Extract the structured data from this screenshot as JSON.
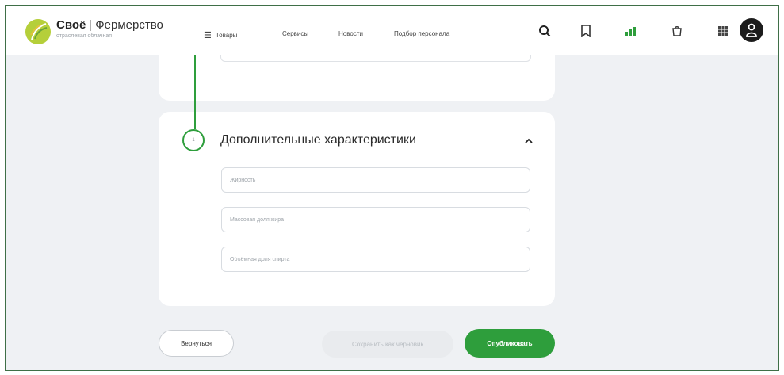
{
  "header": {
    "logo": {
      "brand": "Своё",
      "separator": "|",
      "product": "Фермерство",
      "tagline": "отраслевая облачная"
    },
    "nav": [
      {
        "label": "Товары",
        "icon": "menu-icon"
      },
      {
        "label": "Сервисы"
      },
      {
        "label": "Новости"
      },
      {
        "label": "Подбор персонала"
      }
    ],
    "icons": [
      "search-icon",
      "bookmark-icon",
      "analytics-icon",
      "cart-icon",
      "apps-grid-icon",
      "user-avatar-icon"
    ]
  },
  "section": {
    "step_number": "1",
    "title": "Дополнительные характеристики",
    "toggle_icon": "chevron-up-icon",
    "fields": [
      {
        "placeholder": "Жирность",
        "value": ""
      },
      {
        "placeholder": "Массовая доля жира",
        "value": ""
      },
      {
        "placeholder": "Объёмная доля спирта",
        "value": ""
      }
    ]
  },
  "actions": {
    "back": "Вернуться",
    "save_draft": "Сохранить как черновик",
    "publish": "Опубликовать"
  },
  "colors": {
    "accent": "#2e9e3c",
    "page_background": "#eff1f4",
    "card": "#ffffff",
    "frame_border": "#3f6f47"
  }
}
